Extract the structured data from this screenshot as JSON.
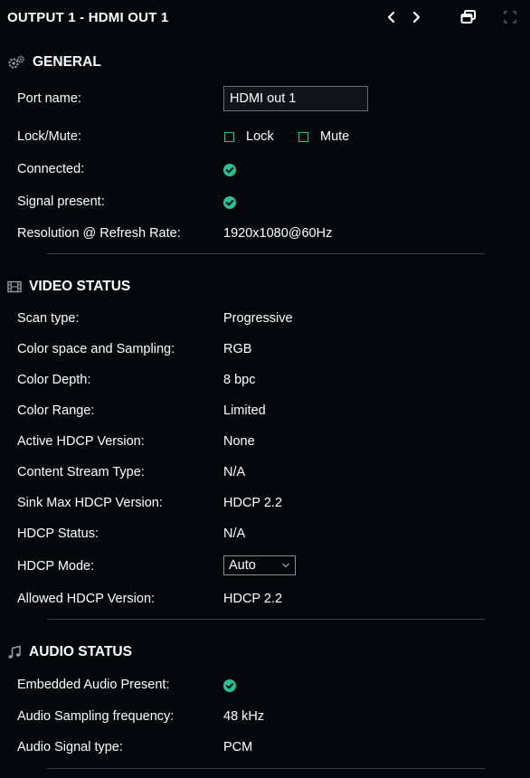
{
  "header": {
    "title": "OUTPUT 1 - HDMI OUT 1",
    "icons": [
      "chevron-left-icon",
      "chevron-right-icon",
      "restore-window-icon",
      "fullscreen-icon"
    ]
  },
  "general": {
    "title": "GENERAL",
    "icon": "gears-icon",
    "port_name_label": "Port name:",
    "port_name_value": "HDMI out 1",
    "lock_mute_label": "Lock/Mute:",
    "lock_label": "Lock",
    "mute_label": "Mute",
    "connected_label": "Connected:",
    "signal_present_label": "Signal present:",
    "resolution_label": "Resolution @ Refresh Rate:",
    "resolution_value": "1920x1080@60Hz"
  },
  "video": {
    "title": "VIDEO STATUS",
    "icon": "film-icon",
    "scan_type_label": "Scan type:",
    "scan_type_value": "Progressive",
    "color_space_label": "Color space and Sampling:",
    "color_space_value": "RGB",
    "color_depth_label": "Color Depth:",
    "color_depth_value": "8 bpc",
    "color_range_label": "Color Range:",
    "color_range_value": "Limited",
    "active_hdcp_label": "Active HDCP Version:",
    "active_hdcp_value": "None",
    "content_stream_label": "Content Stream Type:",
    "content_stream_value": "N/A",
    "sink_max_label": "Sink Max HDCP Version:",
    "sink_max_value": "HDCP 2.2",
    "hdcp_status_label": "HDCP Status:",
    "hdcp_status_value": "N/A",
    "hdcp_mode_label": "HDCP Mode:",
    "hdcp_mode_value": "Auto",
    "allowed_hdcp_label": "Allowed HDCP Version:",
    "allowed_hdcp_value": "HDCP 2.2"
  },
  "audio": {
    "title": "AUDIO STATUS",
    "icon": "music-note-icon",
    "embedded_label": "Embedded Audio Present:",
    "sampling_label": "Audio Sampling frequency:",
    "sampling_value": "48 kHz",
    "signal_type_label": "Audio Signal type:",
    "signal_type_value": "PCM"
  },
  "colors": {
    "background": "#05060b",
    "accent": "#2bbf8f",
    "divider": "#3a3b42"
  }
}
